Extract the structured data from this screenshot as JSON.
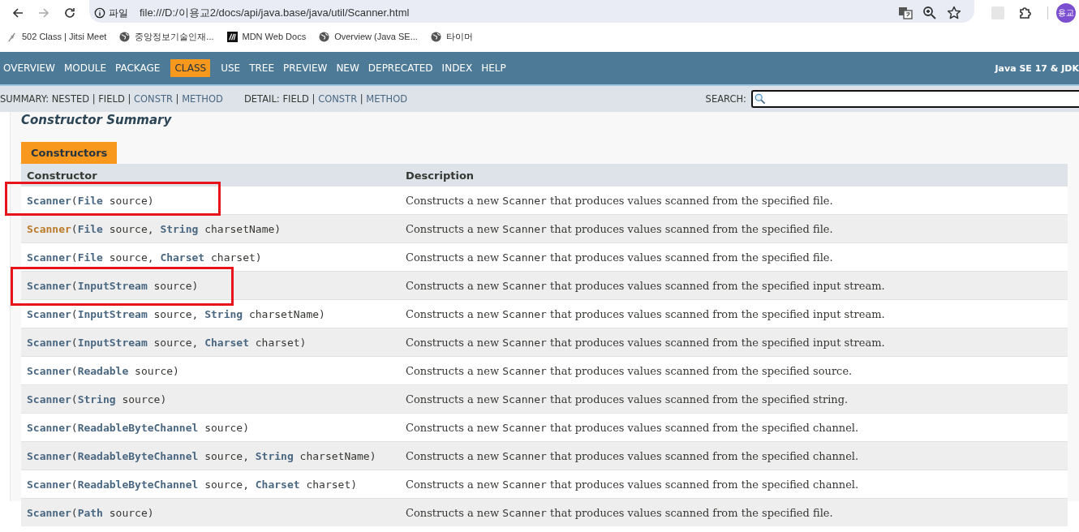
{
  "browser": {
    "url_badge": "파일",
    "url": "file:///D:/이용교2/docs/api/java.base/java/util/Scanner.html",
    "avatar": "용교",
    "bookmarks": [
      {
        "label": "502 Class | Jitsi Meet",
        "kind": "jitsi"
      },
      {
        "label": "중앙정보기술인재...",
        "kind": "globe"
      },
      {
        "label": "MDN Web Docs",
        "kind": "mdn"
      },
      {
        "label": "Overview (Java SE...",
        "kind": "globe"
      },
      {
        "label": "타이머",
        "kind": "globe"
      }
    ]
  },
  "nav": {
    "items": [
      {
        "label": "OVERVIEW",
        "selected": false
      },
      {
        "label": "MODULE",
        "selected": false
      },
      {
        "label": "PACKAGE",
        "selected": false
      },
      {
        "label": "CLASS",
        "selected": true
      },
      {
        "label": "USE",
        "selected": false
      },
      {
        "label": "TREE",
        "selected": false
      },
      {
        "label": "PREVIEW",
        "selected": false
      },
      {
        "label": "NEW",
        "selected": false
      },
      {
        "label": "DEPRECATED",
        "selected": false
      },
      {
        "label": "INDEX",
        "selected": false
      },
      {
        "label": "HELP",
        "selected": false
      }
    ],
    "title": "Java SE 17 & JDK"
  },
  "subnav": {
    "separator": "|",
    "groups": [
      {
        "label": "SUMMARY:",
        "links": [
          {
            "label": "NESTED",
            "linked": false
          },
          {
            "label": "FIELD",
            "linked": false
          },
          {
            "label": "CONSTR",
            "linked": true
          },
          {
            "label": "METHOD",
            "linked": true
          }
        ]
      },
      {
        "label": "DETAIL:",
        "links": [
          {
            "label": "FIELD",
            "linked": false
          },
          {
            "label": "CONSTR",
            "linked": true
          },
          {
            "label": "METHOD",
            "linked": true
          }
        ]
      }
    ],
    "search_label": "SEARCH:"
  },
  "section": {
    "heading": "Constructor Summary",
    "tab": "Constructors",
    "columns": [
      "Constructor",
      "Description"
    ],
    "rows": [
      {
        "hovered": false,
        "annotated": true,
        "signature": [
          {
            "kind": "name",
            "text": "Scanner"
          },
          {
            "kind": "text",
            "text": "("
          },
          {
            "kind": "type",
            "text": "File"
          },
          {
            "kind": "text",
            "text": " source)"
          }
        ],
        "description": {
          "before": "Constructs a new ",
          "code": "Scanner",
          "after": " that produces values scanned from the specified file."
        }
      },
      {
        "hovered": true,
        "annotated": false,
        "signature": [
          {
            "kind": "name",
            "text": "Scanner"
          },
          {
            "kind": "text",
            "text": "("
          },
          {
            "kind": "type",
            "text": "File"
          },
          {
            "kind": "text",
            "text": " source, "
          },
          {
            "kind": "type",
            "text": "String"
          },
          {
            "kind": "text",
            "text": " charsetName)"
          }
        ],
        "description": {
          "before": "Constructs a new ",
          "code": "Scanner",
          "after": " that produces values scanned from the specified file."
        }
      },
      {
        "hovered": false,
        "annotated": false,
        "signature": [
          {
            "kind": "name",
            "text": "Scanner"
          },
          {
            "kind": "text",
            "text": "("
          },
          {
            "kind": "type",
            "text": "File"
          },
          {
            "kind": "text",
            "text": " source, "
          },
          {
            "kind": "type",
            "text": "Charset"
          },
          {
            "kind": "text",
            "text": " charset)"
          }
        ],
        "description": {
          "before": "Constructs a new ",
          "code": "Scanner",
          "after": " that produces values scanned from the specified file."
        }
      },
      {
        "hovered": false,
        "annotated": true,
        "signature": [
          {
            "kind": "name",
            "text": "Scanner"
          },
          {
            "kind": "text",
            "text": "("
          },
          {
            "kind": "type",
            "text": "InputStream"
          },
          {
            "kind": "text",
            "text": " source)"
          }
        ],
        "description": {
          "before": "Constructs a new ",
          "code": "Scanner",
          "after": " that produces values scanned from the specified input stream."
        }
      },
      {
        "hovered": false,
        "annotated": false,
        "signature": [
          {
            "kind": "name",
            "text": "Scanner"
          },
          {
            "kind": "text",
            "text": "("
          },
          {
            "kind": "type",
            "text": "InputStream"
          },
          {
            "kind": "text",
            "text": " source, "
          },
          {
            "kind": "type",
            "text": "String"
          },
          {
            "kind": "text",
            "text": " charsetName)"
          }
        ],
        "description": {
          "before": "Constructs a new ",
          "code": "Scanner",
          "after": " that produces values scanned from the specified input stream."
        }
      },
      {
        "hovered": false,
        "annotated": false,
        "signature": [
          {
            "kind": "name",
            "text": "Scanner"
          },
          {
            "kind": "text",
            "text": "("
          },
          {
            "kind": "type",
            "text": "InputStream"
          },
          {
            "kind": "text",
            "text": " source, "
          },
          {
            "kind": "type",
            "text": "Charset"
          },
          {
            "kind": "text",
            "text": " charset)"
          }
        ],
        "description": {
          "before": "Constructs a new ",
          "code": "Scanner",
          "after": " that produces values scanned from the specified input stream."
        }
      },
      {
        "hovered": false,
        "annotated": false,
        "signature": [
          {
            "kind": "name",
            "text": "Scanner"
          },
          {
            "kind": "text",
            "text": "("
          },
          {
            "kind": "type",
            "text": "Readable"
          },
          {
            "kind": "text",
            "text": " source)"
          }
        ],
        "description": {
          "before": "Constructs a new ",
          "code": "Scanner",
          "after": " that produces values scanned from the specified source."
        }
      },
      {
        "hovered": false,
        "annotated": false,
        "signature": [
          {
            "kind": "name",
            "text": "Scanner"
          },
          {
            "kind": "text",
            "text": "("
          },
          {
            "kind": "type",
            "text": "String"
          },
          {
            "kind": "text",
            "text": " source)"
          }
        ],
        "description": {
          "before": "Constructs a new ",
          "code": "Scanner",
          "after": " that produces values scanned from the specified string."
        }
      },
      {
        "hovered": false,
        "annotated": false,
        "signature": [
          {
            "kind": "name",
            "text": "Scanner"
          },
          {
            "kind": "text",
            "text": "("
          },
          {
            "kind": "type",
            "text": "ReadableByteChannel"
          },
          {
            "kind": "text",
            "text": " source)"
          }
        ],
        "description": {
          "before": "Constructs a new ",
          "code": "Scanner",
          "after": " that produces values scanned from the specified channel."
        }
      },
      {
        "hovered": false,
        "annotated": false,
        "signature": [
          {
            "kind": "name",
            "text": "Scanner"
          },
          {
            "kind": "text",
            "text": "("
          },
          {
            "kind": "type",
            "text": "ReadableByteChannel"
          },
          {
            "kind": "text",
            "text": " source, "
          },
          {
            "kind": "type",
            "text": "String"
          },
          {
            "kind": "text",
            "text": " charsetName)"
          }
        ],
        "description": {
          "before": "Constructs a new ",
          "code": "Scanner",
          "after": " that produces values scanned from the specified channel."
        }
      },
      {
        "hovered": false,
        "annotated": false,
        "signature": [
          {
            "kind": "name",
            "text": "Scanner"
          },
          {
            "kind": "text",
            "text": "("
          },
          {
            "kind": "type",
            "text": "ReadableByteChannel"
          },
          {
            "kind": "text",
            "text": " source, "
          },
          {
            "kind": "type",
            "text": "Charset"
          },
          {
            "kind": "text",
            "text": " charset)"
          }
        ],
        "description": {
          "before": "Constructs a new ",
          "code": "Scanner",
          "after": " that produces values scanned from the specified channel."
        }
      },
      {
        "hovered": false,
        "annotated": false,
        "signature": [
          {
            "kind": "name",
            "text": "Scanner"
          },
          {
            "kind": "text",
            "text": "("
          },
          {
            "kind": "type",
            "text": "Path"
          },
          {
            "kind": "text",
            "text": " source)"
          }
        ],
        "description": {
          "before": "Constructs a new ",
          "code": "Scanner",
          "after": " that produces values scanned from the specified file."
        }
      }
    ]
  }
}
